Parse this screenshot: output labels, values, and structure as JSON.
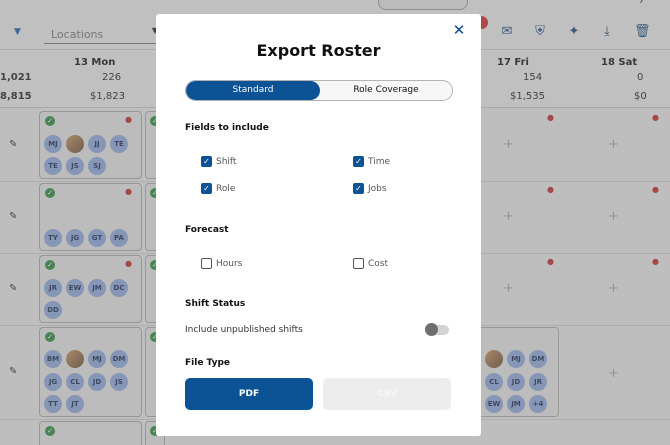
{
  "toolbar": {
    "location_placeholder": "Locations",
    "icons": [
      "menu-caret",
      "mail-icon",
      "shield-icon",
      "sparkle-icon",
      "download-icon",
      "trash-icon"
    ]
  },
  "days": {
    "mon": "13  Mon",
    "fri": "17  Fri",
    "sat": "18  Sat"
  },
  "stats": {
    "left_top": "1,021",
    "left_bottom": "8,815",
    "mon_hours": "226",
    "mon_cost": "$1,823",
    "fri_hours": "154",
    "fri_cost": "$1,535",
    "sat_hours": "0",
    "sat_cost": "$0"
  },
  "rows": {
    "row1": [
      "MJ",
      "JJ",
      "TE",
      "TE",
      "JS",
      "SJ"
    ],
    "row2": [
      "TY",
      "JG",
      "GT",
      "PA"
    ],
    "row3": [
      "JR",
      "EW",
      "JM",
      "DC",
      "DD"
    ],
    "row4": [
      "BM",
      "MJ",
      "DM",
      "JG",
      "CL",
      "JD",
      "JS",
      "TT",
      "JT"
    ],
    "fri_row4": [
      "MJ",
      "DM",
      "CL",
      "JD",
      "JR",
      "EW",
      "JM",
      "+4"
    ]
  },
  "modal": {
    "title": "Export Roster",
    "tabs": [
      "Standard",
      "Role Coverage"
    ],
    "fields_title": "Fields to include",
    "fields": [
      "Shift",
      "Time",
      "Role",
      "Jobs"
    ],
    "forecast_title": "Forecast",
    "forecast": [
      "Hours",
      "Cost"
    ],
    "status_title": "Shift Status",
    "status_label": "Include unpublished shifts",
    "filetype_title": "File Type",
    "pdf_label": "PDF",
    "csv_label": "CSV"
  },
  "colors": {
    "primary": "#0b5394",
    "check_green": "#2e8b3a",
    "alert_red": "#c62828",
    "avatar": "#8fa9dd"
  }
}
